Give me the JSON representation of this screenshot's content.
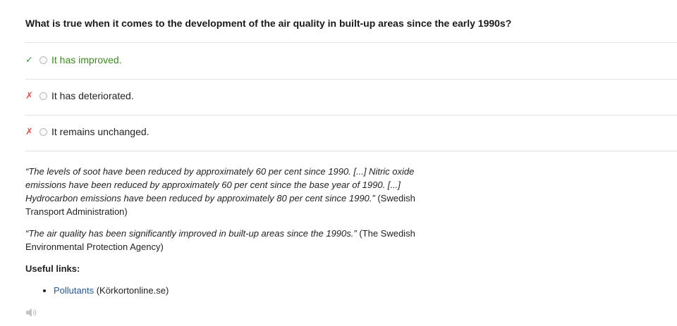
{
  "question": {
    "text": "What is true when it comes to the development of the air quality in built-up areas since the early 1990s?"
  },
  "answers": [
    {
      "mark": "✓",
      "label": "It has improved.",
      "status": "correct"
    },
    {
      "mark": "✗",
      "label": "It has deteriorated.",
      "status": "wrong"
    },
    {
      "mark": "✗",
      "label": "It remains unchanged.",
      "status": "wrong"
    }
  ],
  "explanation": {
    "paragraph1": {
      "quote": "“The levels of soot have been reduced by approximately 60 per cent since 1990. [...] Nitric oxide emissions have been reduced by approximately 60 per cent since the base year of 1990. [...] Hydrocarbon emissions have been reduced by approximately 80 per cent since 1990.”",
      "source": " (Swedish Transport Administration)"
    },
    "paragraph2": {
      "quote": "“The air quality has been significantly improved in built-up areas since the 1990s.”",
      "source": " (The Swedish Environmental Protection Agency)"
    },
    "links_heading": "Useful links:",
    "links": [
      {
        "label": "Pollutants",
        "suffix": " (Körkortonline.se)"
      }
    ]
  },
  "icons": {
    "audio": "speaker-icon"
  },
  "colors": {
    "correct_text": "#3a8a1e",
    "correct_mark": "#3c9a3c",
    "wrong_mark": "#d9534f",
    "link": "#1f57a6",
    "divider": "#e3e3e3"
  }
}
